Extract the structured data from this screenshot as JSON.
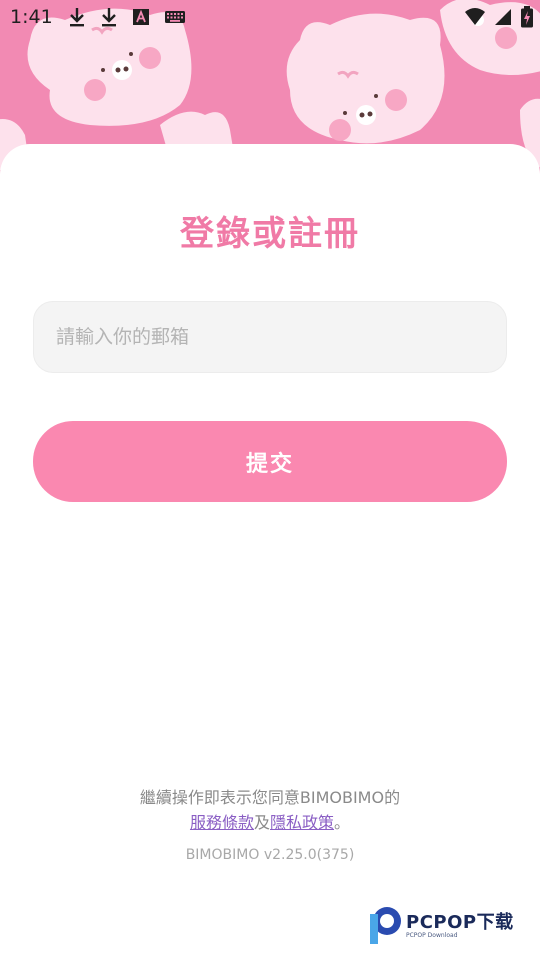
{
  "status_bar": {
    "time": "1:41",
    "left_icons": [
      "download-icon",
      "download-icon",
      "text-a-icon",
      "keyboard-icon"
    ],
    "right_icons": [
      "wifi-icon",
      "signal-icon",
      "battery-charging-icon"
    ]
  },
  "header": {
    "background_color": "#f28ab3",
    "pattern": "cat-faces"
  },
  "login": {
    "title": "登錄或註冊",
    "email_placeholder": "請輸入你的郵箱",
    "email_value": "",
    "submit_label": "提交",
    "accent_color": "#fa88b0"
  },
  "footer": {
    "agreement_prefix": "繼續操作即表示您同意BIMOBIMO的",
    "terms_link": "服務條款",
    "and_text": "及",
    "privacy_link": "隱私政策",
    "end_punct": "。",
    "version": "BIMOBIMO v2.25.0(375)"
  },
  "watermark": {
    "brand": "PCPOP下载",
    "sub": "PCPOP Download"
  }
}
